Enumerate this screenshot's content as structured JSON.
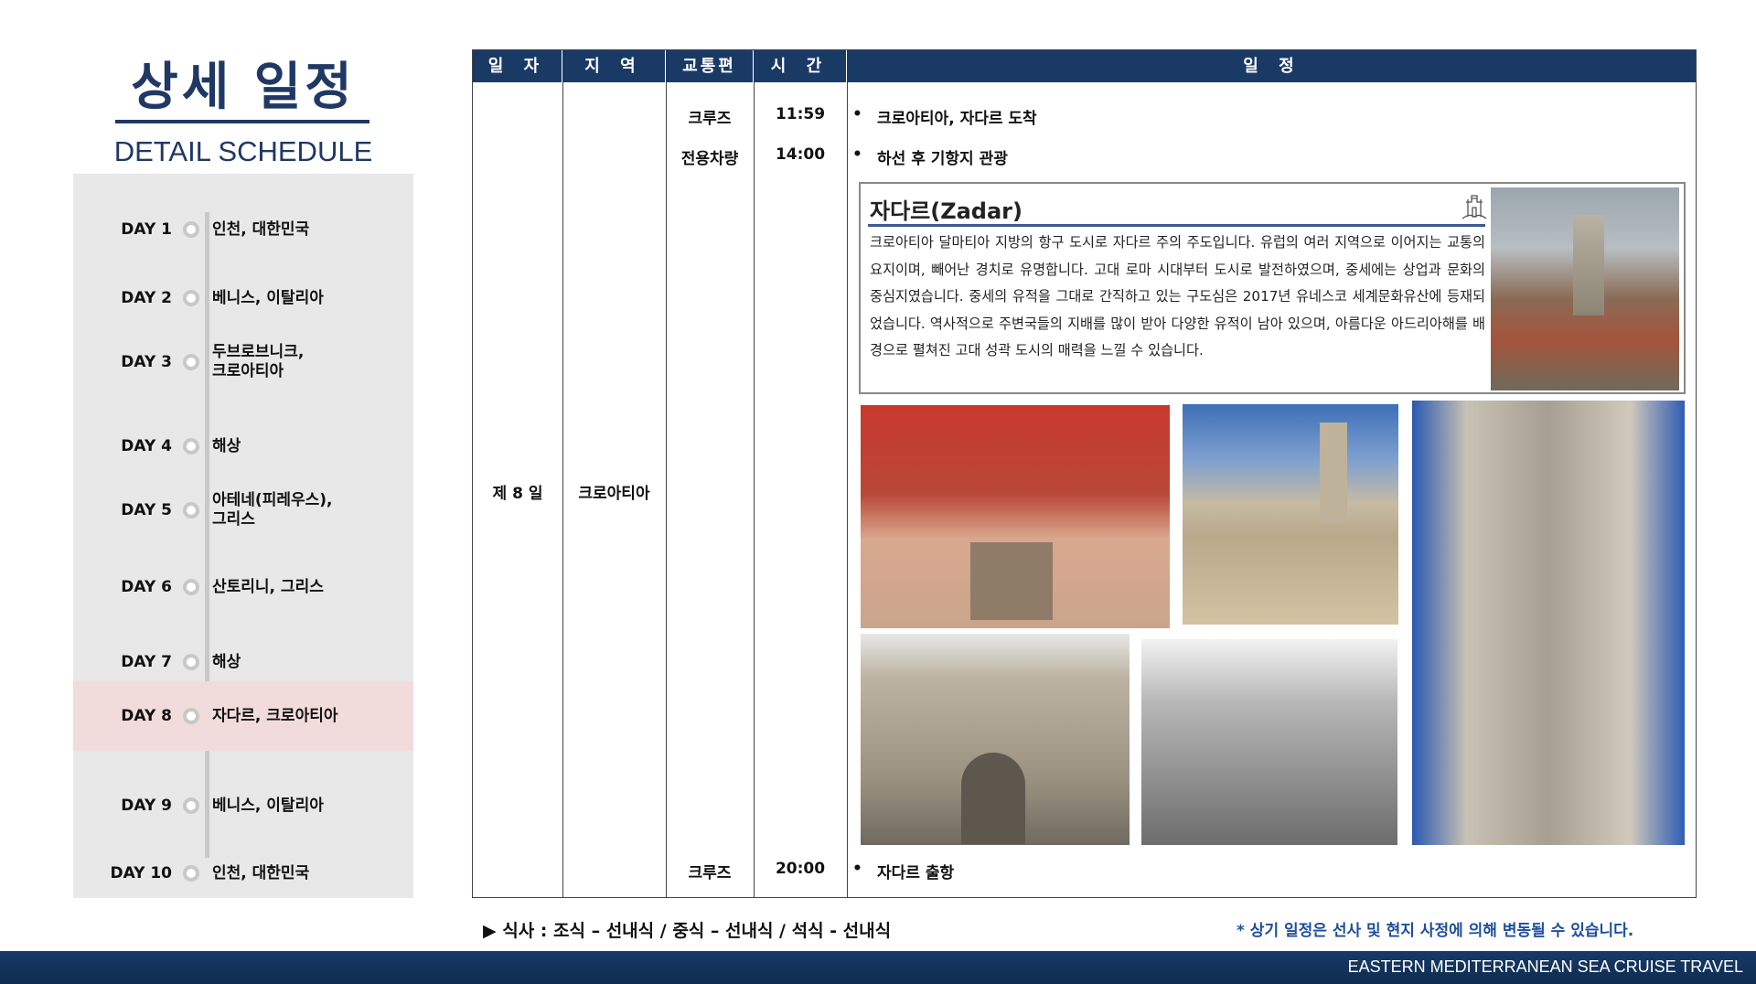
{
  "header": {
    "title": "상세 일정",
    "subtitle": "DETAIL SCHEDULE"
  },
  "sidebar": {
    "days": [
      {
        "day": "DAY 1",
        "place": "인천, 대한민국"
      },
      {
        "day": "DAY 2",
        "place": "베니스, 이탈리아"
      },
      {
        "day": "DAY 3",
        "place": "두브로브니크,\n크로아티아"
      },
      {
        "day": "DAY 4",
        "place": "해상"
      },
      {
        "day": "DAY 5",
        "place": "아테네(피레우스),\n그리스"
      },
      {
        "day": "DAY 6",
        "place": "산토리니, 그리스"
      },
      {
        "day": "DAY 7",
        "place": "해상"
      },
      {
        "day": "DAY 8",
        "place": "자다르, 크로아티아",
        "active": true
      },
      {
        "day": "DAY 9",
        "place": "베니스, 이탈리아"
      },
      {
        "day": "DAY 10",
        "place": "인천, 대한민국"
      }
    ]
  },
  "table": {
    "headers": [
      "일 자",
      "지 역",
      "교통편",
      "시 간",
      "일 정"
    ],
    "day": "제 8 일",
    "region": "크로아티아",
    "rows": [
      {
        "transport": "크루즈",
        "time": "11:59",
        "item": "크로아티아, 자다르 도착"
      },
      {
        "transport": "전용차량",
        "time": "14:00",
        "item": "하선 후 기항지 관광"
      },
      {
        "transport": "크루즈",
        "time": "20:00",
        "item": "자다르 출항"
      }
    ],
    "bullet": "•"
  },
  "zadar": {
    "title": "자다르(Zadar)",
    "icon": "castle-icon",
    "text": "크로아티아 달마티아 지방의 항구 도시로 자다르 주의 주도입니다. 유럽의 여러 지역으로 이어지는 교통의 요지이며, 빼어난 경치로 유명합니다. 고대 로마 시대부터 도시로 발전하였으며, 중세에는 상업과 문화의 중심지였습니다. 중세의 유적을 그대로 간직하고 있는 구도심은 2017년 유네스코 세계문화유산에 등재되었습니다. 역사적으로  주변국들의 지배를 많이 받아 다양한 유적이 남아 있으며, 아름다운 아드리아해를 배경으로 펼쳐진 고대 성곽 도시의 매력을 느낄 수 있습니다."
  },
  "footer": {
    "meals": "▶ 식사 : 조식 – 선내식 / 중식 – 선내식 / 석식 - 선내식",
    "notice": "* 상기 일정은 선사 및 현지 사정에 의해 변동될 수 있습니다.",
    "brand": "EASTERN MEDITERRANEAN SEA CRUISE TRAVEL"
  },
  "colors": {
    "navy": "#1a3a66",
    "highlight": "#f2dcdb",
    "notice": "#1f4e9c"
  }
}
